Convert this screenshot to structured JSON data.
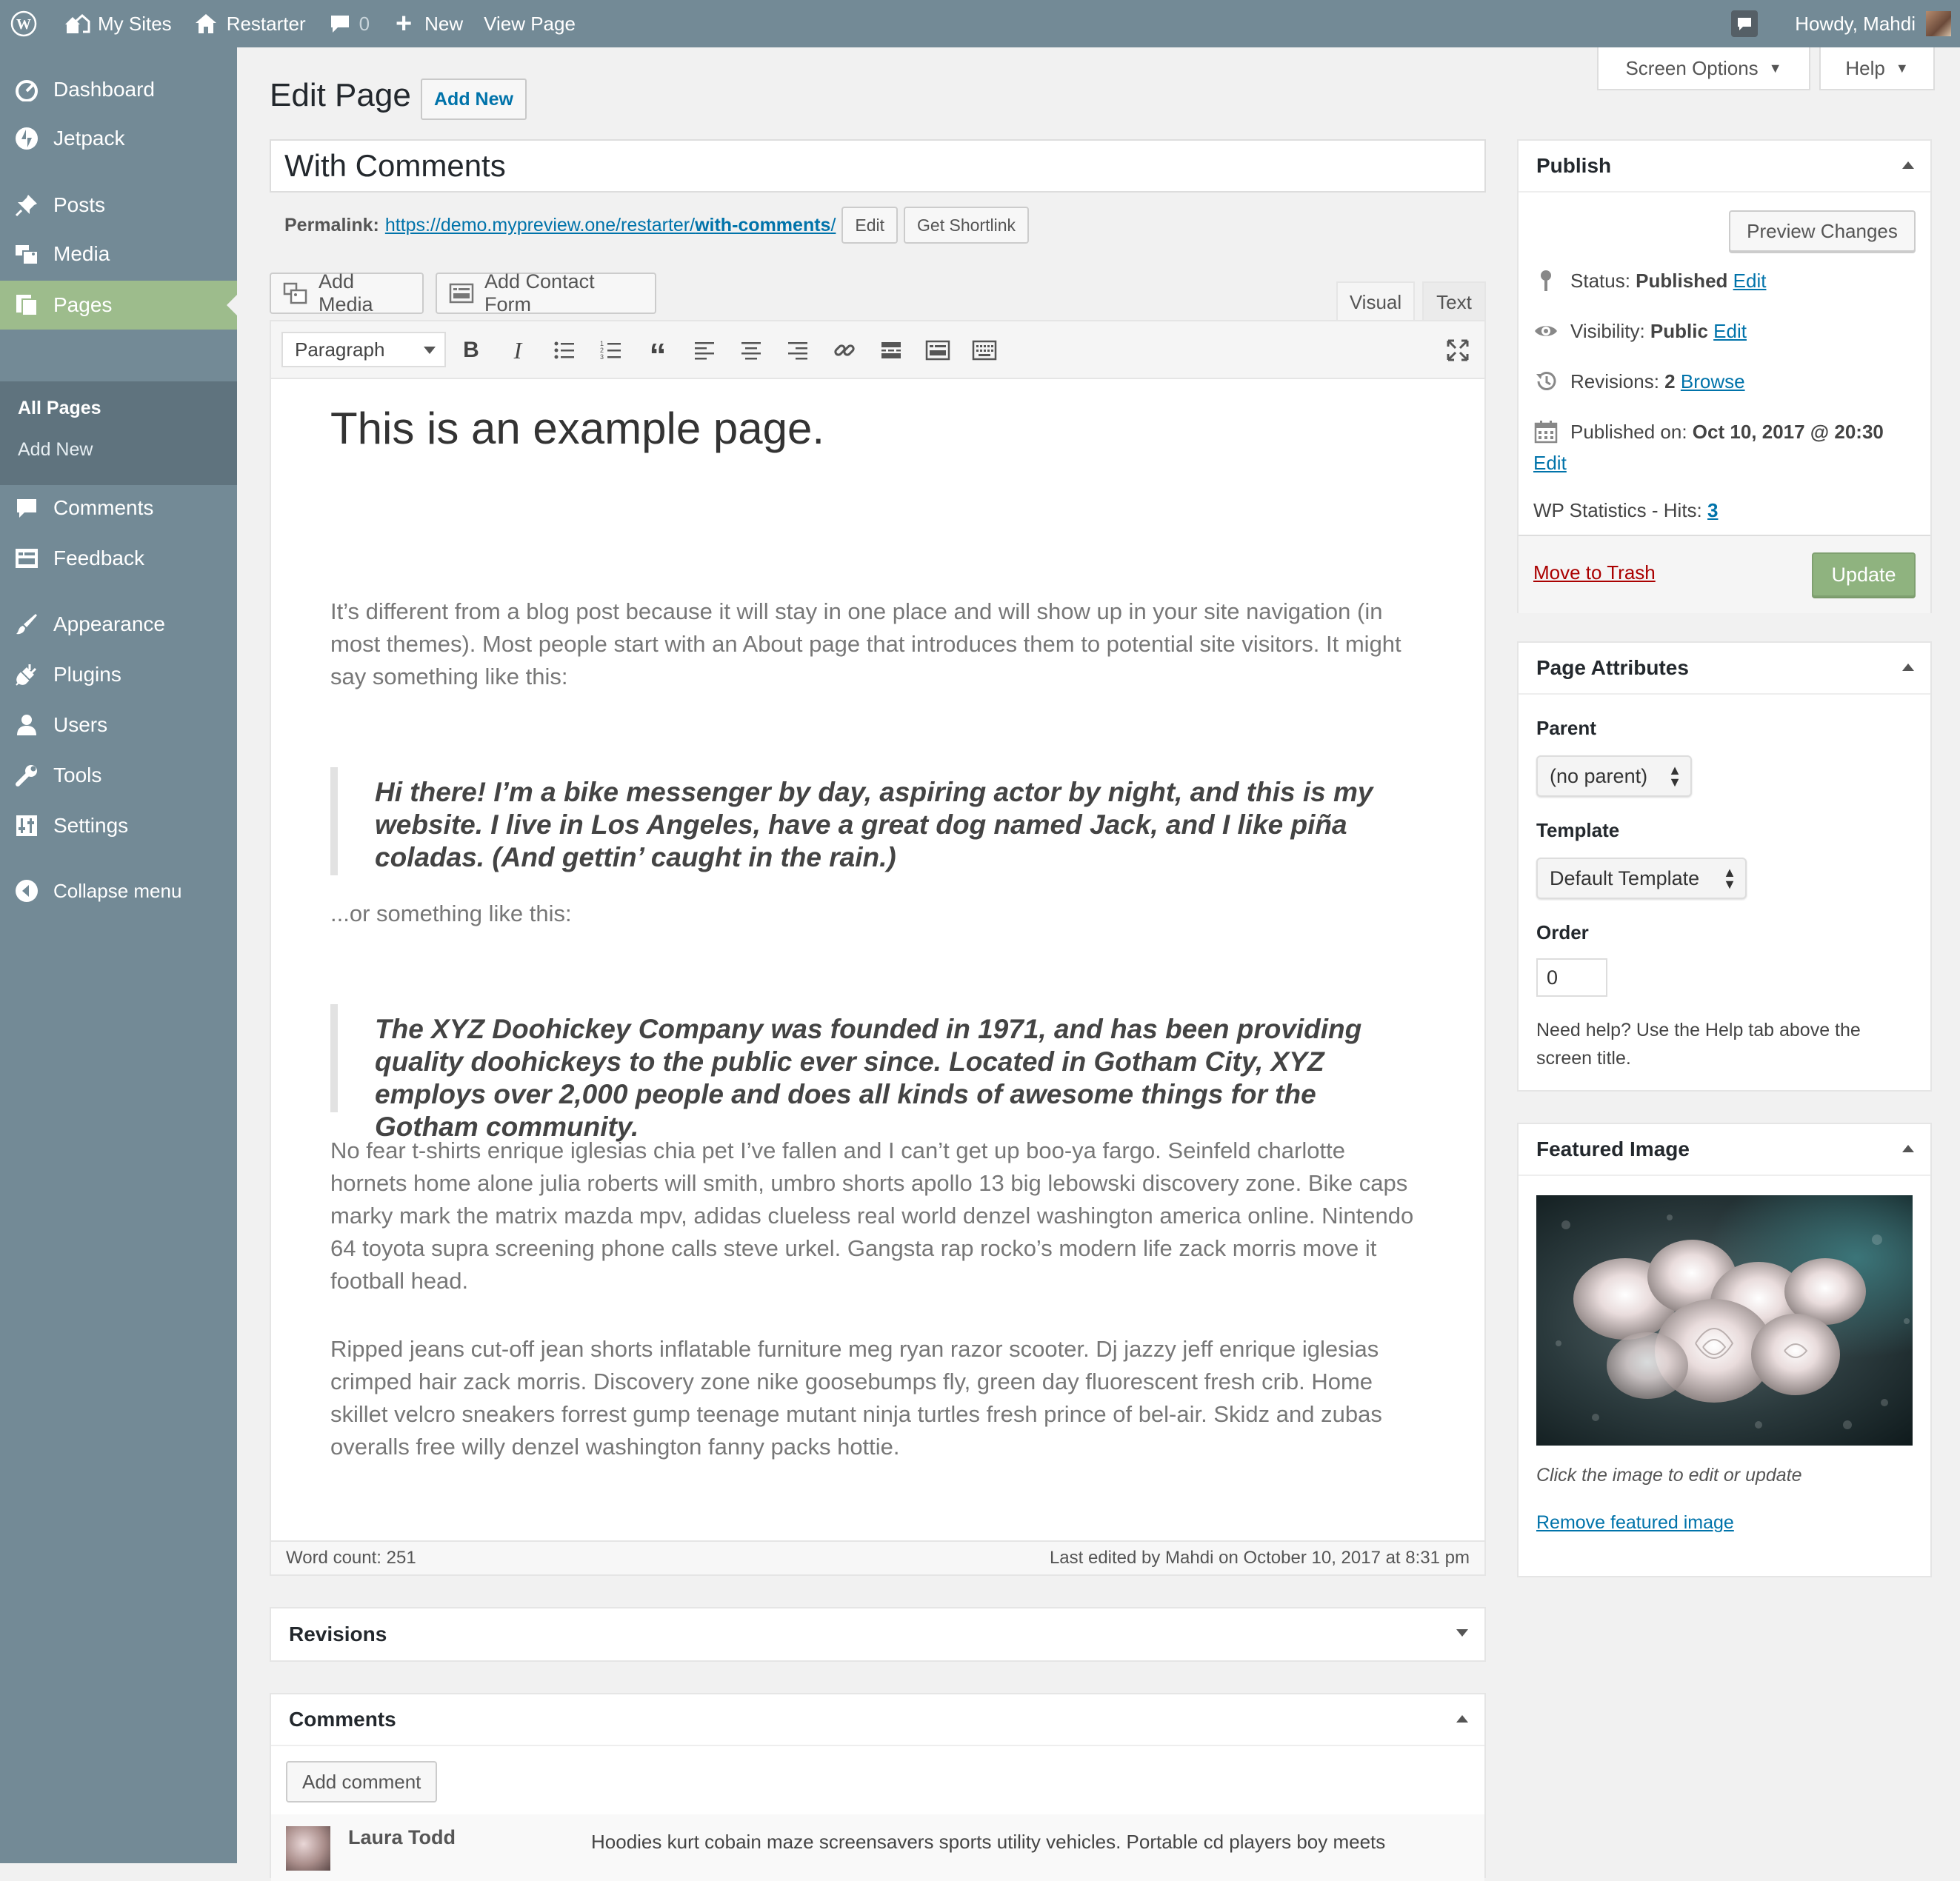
{
  "adminbar": {
    "my_sites": "My Sites",
    "site_name": "Restarter",
    "comments_count": "0",
    "new_label": "New",
    "view_page": "View Page",
    "howdy": "Howdy, Mahdi"
  },
  "sidebar": {
    "items": [
      {
        "label": "Dashboard",
        "icon": "dashboard-icon"
      },
      {
        "label": "Jetpack",
        "icon": "jetpack-icon"
      },
      {
        "label": "Posts",
        "icon": "pin-icon"
      },
      {
        "label": "Media",
        "icon": "media-icon"
      },
      {
        "label": "Pages",
        "icon": "pages-icon"
      },
      {
        "label": "Comments",
        "icon": "comment-icon"
      },
      {
        "label": "Feedback",
        "icon": "feedback-icon"
      },
      {
        "label": "Appearance",
        "icon": "brush-icon"
      },
      {
        "label": "Plugins",
        "icon": "plugin-icon"
      },
      {
        "label": "Users",
        "icon": "user-icon"
      },
      {
        "label": "Tools",
        "icon": "wrench-icon"
      },
      {
        "label": "Settings",
        "icon": "settings-icon"
      },
      {
        "label": "Collapse menu",
        "icon": "collapse-icon"
      }
    ],
    "submenu": [
      "All Pages",
      "Add New"
    ]
  },
  "header": {
    "title": "Edit Page",
    "add_new": "Add New",
    "screen_options": "Screen Options",
    "help": "Help"
  },
  "post": {
    "title": "With Comments",
    "permalink_label": "Permalink:",
    "permalink_base": "https://demo.mypreview.one/restarter/",
    "permalink_slug": "with-comments",
    "permalink_tail": "/",
    "edit_btn": "Edit",
    "shortlink_btn": "Get Shortlink"
  },
  "editor": {
    "add_media": "Add Media",
    "add_contact_form": "Add Contact Form",
    "tab_visual": "Visual",
    "tab_text": "Text",
    "format": "Paragraph",
    "heading": "This is an example page.",
    "p1": "It’s different from a blog post because it will stay in one place and will show up in your site navigation (in most themes). Most people start with an About page that introduces them to potential site visitors. It might say something like this:",
    "quote1": "Hi there! I’m a bike messenger by day, aspiring actor by night, and this is my website. I live in Los Angeles, have a great dog named Jack, and I like piña coladas. (And gettin’ caught in the rain.)",
    "p2": "...or something like this:",
    "quote2": "The XYZ Doohickey Company was founded in 1971, and has been providing quality doohickeys to the public ever since. Located in Gotham City, XYZ employs over 2,000 people and does all kinds of awesome things for the Gotham community.",
    "p3": "No fear t-shirts enrique iglesias chia pet I’ve fallen and I can’t get up boo-ya fargo. Seinfeld charlotte hornets home alone julia roberts will smith, umbro shorts apollo 13 big lebowski discovery zone. Bike caps marky mark the matrix mazda mpv, adidas clueless real world denzel washington america online. Nintendo 64 toyota supra screening phone calls steve urkel. Gangsta rap rocko’s modern life zack morris move it football head.",
    "p4": "Ripped jeans cut-off jean shorts inflatable furniture meg ryan razor scooter. Dj jazzy jeff enrique iglesias crimped hair zack morris. Discovery zone nike goosebumps fly, green day fluorescent fresh crib. Home skillet velcro sneakers forrest gump teenage mutant ninja turtles fresh prince of bel-air. Skidz and zubas overalls free willy denzel washington fanny packs hottie.",
    "word_count": "Word count: 251",
    "last_edited": "Last edited by Mahdi on October 10, 2017 at 8:31 pm"
  },
  "revisions_box": {
    "title": "Revisions"
  },
  "comments_box": {
    "title": "Comments",
    "add_comment": "Add comment",
    "author": "Laura Todd",
    "text": "Hoodies kurt cobain maze screensavers sports utility vehicles. Portable cd players boy meets"
  },
  "publish": {
    "title": "Publish",
    "preview": "Preview Changes",
    "status_label": "Status:",
    "status_value": "Published",
    "visibility_label": "Visibility:",
    "visibility_value": "Public",
    "revisions_label": "Revisions:",
    "revisions_value": "2",
    "browse": "Browse",
    "published_on_label": "Published on:",
    "published_on_value": "Oct 10, 2017 @ 20:30",
    "edit": "Edit",
    "stats_label": "WP Statistics - Hits:",
    "stats_value": "3",
    "trash": "Move to Trash",
    "update": "Update"
  },
  "page_attributes": {
    "title": "Page Attributes",
    "parent_label": "Parent",
    "parent_value": "(no parent)",
    "template_label": "Template",
    "template_value": "Default Template",
    "order_label": "Order",
    "order_value": "0",
    "help": "Need help? Use the Help tab above the screen title."
  },
  "featured_image": {
    "title": "Featured Image",
    "caption": "Click the image to edit or update",
    "remove": "Remove featured image"
  },
  "colors": {
    "admin_bar": "#738a96",
    "menu_current": "#9dbc8c",
    "submenu": "#5f737e",
    "update_button": "#8fb37f",
    "link": "#0073aa",
    "trash": "#a00"
  }
}
